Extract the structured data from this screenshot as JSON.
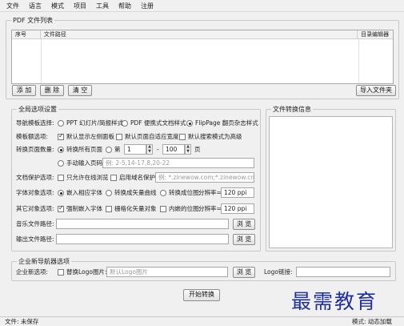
{
  "menu": [
    "文件",
    "语言",
    "模式",
    "项目",
    "工具",
    "帮助",
    "注册"
  ],
  "pdf_list": {
    "legend": "PDF 文件列表",
    "columns": [
      "序号",
      "文件路径",
      "目录编辑器"
    ]
  },
  "list_buttons": {
    "add": "添 加",
    "delete": "删 除",
    "clear": "清 空",
    "import_folder": "导入文件夹"
  },
  "global": {
    "legend": "全局选项设置",
    "nav_template": {
      "label": "导航模板选择:",
      "options": [
        "PPT 幻灯片/简报样式",
        "PDF 便携式文档样式",
        "FlipPage 翻页杂志样式"
      ],
      "selected": 2
    },
    "template_opts": {
      "label": "模板额选项:",
      "items": [
        {
          "text": "默认显示左侧面板",
          "checked": true
        },
        {
          "text": "默认页面自适应宽度",
          "checked": false
        },
        {
          "text": "默认搜索模式为高级",
          "checked": false
        }
      ]
    },
    "page_range": {
      "label": "转换页面数量:",
      "all_pages": "转换所有页面",
      "from": "第",
      "from_value": "1",
      "dash": "-",
      "to_value": "100",
      "unit": "页",
      "manual": "手动输入页码",
      "manual_placeholder": "例: 2-5,14-17,8,20-22"
    },
    "protection": {
      "label": "文档保护选项:",
      "only_in_browser": "只允许在线浏览",
      "enable_domain": "启用域名保护",
      "domain_placeholder": "例: *.zinewow.com;*.zinewow.cn"
    },
    "font": {
      "label": "字体对象选项:",
      "embed": "嵌入相应字体",
      "vector": "转换成矢量曲线",
      "bitmap": "转换成位图:",
      "dpi_label": "分辨率=",
      "dpi_value": "120 ppi"
    },
    "other": {
      "label": "其它对象选项:",
      "force_embed": "强制嵌入字体",
      "rasterize": "栅格化矢量对象",
      "inner_bitmap": "内嵌的位图:",
      "dpi_label": "分辨率=",
      "dpi_value": "120 ppi"
    },
    "music_path": {
      "label": "音乐文件路径:",
      "value": ""
    },
    "output_path": {
      "label": "输出文件路径:",
      "value": ""
    },
    "browse": "浏 览"
  },
  "convert_info": {
    "legend": "文件转换信息"
  },
  "enterprise": {
    "legend": "企业新导航器选项",
    "label": "企业新选项:",
    "replace_logo": "替换Logo图片:",
    "logo_placeholder": "默认Logo图片",
    "browse": "浏 览",
    "logo_link_label": "Logo链接:",
    "logo_link_value": ""
  },
  "start_button": "开始转换",
  "status": {
    "text": "文件: 未保存",
    "right": "模式: 动态加载"
  },
  "watermark": "最需教育"
}
